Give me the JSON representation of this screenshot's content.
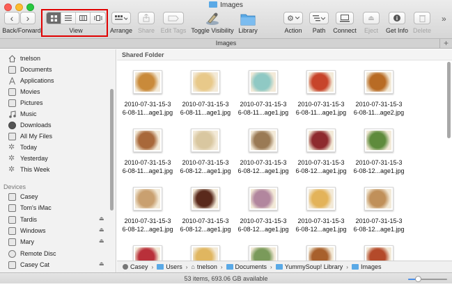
{
  "window": {
    "title": "Images"
  },
  "toolbar": {
    "back_forward_label": "Back/Forward",
    "view_label": "View",
    "arrange_label": "Arrange",
    "share_label": "Share",
    "edit_tags_label": "Edit Tags",
    "toggle_visibility_label": "Toggle Visibility",
    "library_label": "Library",
    "action_label": "Action",
    "path_label": "Path",
    "connect_label": "Connect",
    "eject_label": "Eject",
    "get_info_label": "Get Info",
    "delete_label": "Delete",
    "overflow": "»",
    "back_glyph": "‹",
    "forward_glyph": "›",
    "info_glyph": "i",
    "gear_glyph": "⚙",
    "eject_glyph": "⏏"
  },
  "tabbar": {
    "title": "Images",
    "plus": "+"
  },
  "sidebar": {
    "favorites": [
      {
        "label": "tnelson",
        "icon": "home-icon"
      },
      {
        "label": "Documents",
        "icon": "documents-icon"
      },
      {
        "label": "Applications",
        "icon": "applications-icon"
      },
      {
        "label": "Movies",
        "icon": "movies-icon"
      },
      {
        "label": "Pictures",
        "icon": "pictures-icon"
      },
      {
        "label": "Music",
        "icon": "music-icon"
      },
      {
        "label": "Downloads",
        "icon": "downloads-icon"
      },
      {
        "label": "All My Files",
        "icon": "all-files-icon"
      },
      {
        "label": "Today",
        "icon": "smart-folder-icon"
      },
      {
        "label": "Yesterday",
        "icon": "smart-folder-icon"
      },
      {
        "label": "This Week",
        "icon": "smart-folder-icon"
      }
    ],
    "devices_heading": "Devices",
    "devices": [
      {
        "label": "Casey",
        "icon": "computer-icon",
        "eject": false
      },
      {
        "label": "Tom's iMac",
        "icon": "imac-icon",
        "eject": false
      },
      {
        "label": "Tardis",
        "icon": "drive-icon",
        "eject": true
      },
      {
        "label": "Windows",
        "icon": "drive-icon",
        "eject": true
      },
      {
        "label": "Mary",
        "icon": "drive-icon",
        "eject": true
      },
      {
        "label": "Remote Disc",
        "icon": "disc-icon",
        "eject": false
      },
      {
        "label": "Casey Cat",
        "icon": "drive-icon",
        "eject": true
      }
    ],
    "eject_glyph": "⏏"
  },
  "content": {
    "section_header": "Shared Folder",
    "files": [
      {
        "line1": "2010-07-31-15-3",
        "line2": "6-08-11...age1.jpg",
        "color": "#c98a3a"
      },
      {
        "line1": "2010-07-31-15-3",
        "line2": "6-08-11...age1.jpg",
        "color": "#e8c98a"
      },
      {
        "line1": "2010-07-31-15-3",
        "line2": "6-08-11...age1.jpg",
        "color": "#8fc9c4"
      },
      {
        "line1": "2010-07-31-15-3",
        "line2": "6-08-11...age1.jpg",
        "color": "#c7442b"
      },
      {
        "line1": "2010-07-31-15-3",
        "line2": "6-08-11...age2.jpg",
        "color": "#b86b25"
      },
      {
        "line1": "2010-07-31-15-3",
        "line2": "6-08-11...age1.jpg",
        "color": "#a8683a"
      },
      {
        "line1": "2010-07-31-15-3",
        "line2": "6-08-12...age1.jpg",
        "color": "#d9c7a0"
      },
      {
        "line1": "2010-07-31-15-3",
        "line2": "6-08-12...age1.jpg",
        "color": "#9a7a55"
      },
      {
        "line1": "2010-07-31-15-3",
        "line2": "6-08-12...age1.jpg",
        "color": "#8e2a2e"
      },
      {
        "line1": "2010-07-31-15-3",
        "line2": "6-08-12...age1.jpg",
        "color": "#5e8b3c"
      },
      {
        "line1": "2010-07-31-15-3",
        "line2": "6-08-12...age1.jpg",
        "color": "#c9a070"
      },
      {
        "line1": "2010-07-31-15-3",
        "line2": "6-08-12...age1.jpg",
        "color": "#5a2a1c"
      },
      {
        "line1": "2010-07-31-15-3",
        "line2": "6-08-12...age1.jpg",
        "color": "#b2869e"
      },
      {
        "line1": "2010-07-31-15-3",
        "line2": "6-08-12...age1.jpg",
        "color": "#e3b35a"
      },
      {
        "line1": "2010-07-31-15-3",
        "line2": "6-08-12...age1.jpg",
        "color": "#c0905a"
      },
      {
        "color": "#b9303a"
      },
      {
        "color": "#e0b660"
      },
      {
        "color": "#7a9a5a"
      },
      {
        "color": "#a8602c"
      },
      {
        "color": "#b44a2a"
      }
    ]
  },
  "pathbar": {
    "crumbs": [
      "Casey",
      "Users",
      "tnelson",
      "Documents",
      "YummySoup! Library",
      "Images"
    ],
    "separator": "›"
  },
  "status": {
    "text": "53 items, 693.06 GB available",
    "icon_size_level": 0.25
  },
  "colors": {
    "highlight": "#e00000",
    "accent": "#4a8ee8",
    "folder": "#5aa9e6"
  }
}
